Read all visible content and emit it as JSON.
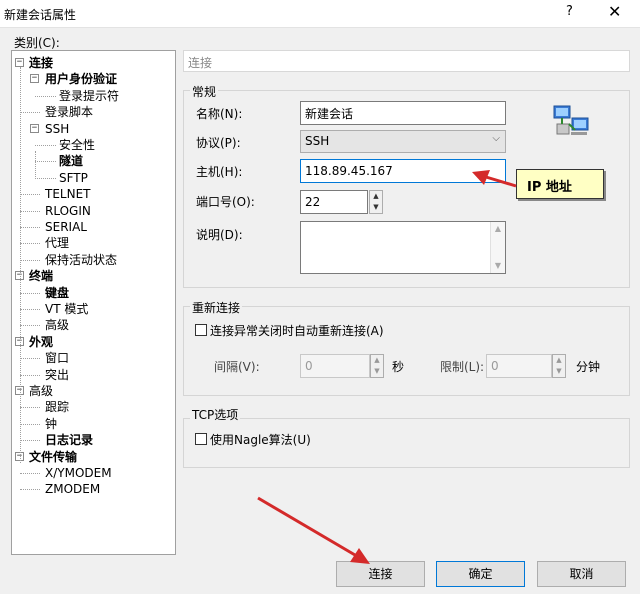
{
  "window": {
    "title": "新建会话属性",
    "help_label": "?",
    "close_label": "✕"
  },
  "category_label": "类别(C):",
  "tree": [
    {
      "label": "连接",
      "bold": true,
      "level": 0,
      "expander": "−"
    },
    {
      "label": "用户身份验证",
      "bold": true,
      "level": 1,
      "expander": "−"
    },
    {
      "label": "登录提示符",
      "bold": false,
      "level": 2
    },
    {
      "label": "登录脚本",
      "bold": false,
      "level": 1
    },
    {
      "label": "SSH",
      "bold": false,
      "level": 1,
      "expander": "−"
    },
    {
      "label": "安全性",
      "bold": false,
      "level": 2
    },
    {
      "label": "隧道",
      "bold": true,
      "level": 2
    },
    {
      "label": "SFTP",
      "bold": false,
      "level": 2
    },
    {
      "label": "TELNET",
      "bold": false,
      "level": 1
    },
    {
      "label": "RLOGIN",
      "bold": false,
      "level": 1
    },
    {
      "label": "SERIAL",
      "bold": false,
      "level": 1
    },
    {
      "label": "代理",
      "bold": false,
      "level": 1
    },
    {
      "label": "保持活动状态",
      "bold": false,
      "level": 1
    },
    {
      "label": "终端",
      "bold": true,
      "level": 0,
      "expander": "−"
    },
    {
      "label": "键盘",
      "bold": true,
      "level": 1
    },
    {
      "label": "VT 模式",
      "bold": false,
      "level": 1
    },
    {
      "label": "高级",
      "bold": false,
      "level": 1
    },
    {
      "label": "外观",
      "bold": true,
      "level": 0,
      "expander": "−"
    },
    {
      "label": "窗口",
      "bold": false,
      "level": 1
    },
    {
      "label": "突出",
      "bold": false,
      "level": 1
    },
    {
      "label": "高级",
      "bold": false,
      "level": 0,
      "expander": "−"
    },
    {
      "label": "跟踪",
      "bold": false,
      "level": 1
    },
    {
      "label": "钟",
      "bold": false,
      "level": 1
    },
    {
      "label": "日志记录",
      "bold": true,
      "level": 1
    },
    {
      "label": "文件传输",
      "bold": true,
      "level": 0,
      "expander": "−"
    },
    {
      "label": "X/YMODEM",
      "bold": false,
      "level": 1
    },
    {
      "label": "ZMODEM",
      "bold": false,
      "level": 1
    }
  ],
  "panel_header": "连接",
  "general": {
    "title": "常规",
    "name_label": "名称(N):",
    "name_value": "新建会话",
    "protocol_label": "协议(P):",
    "protocol_value": "SSH",
    "host_label": "主机(H):",
    "host_value": "118.89.45.167",
    "port_label": "端口号(O):",
    "port_value": "22",
    "desc_label": "说明(D):",
    "desc_value": "",
    "icon": "network-computers-icon"
  },
  "reconnect": {
    "title": "重新连接",
    "checkbox_label": "连接异常关闭时自动重新连接(A)",
    "checked": false,
    "interval_label": "间隔(V):",
    "interval_value": "0",
    "interval_unit": "秒",
    "limit_label": "限制(L):",
    "limit_value": "0",
    "limit_unit": "分钟"
  },
  "tcp": {
    "title": "TCP选项",
    "nagle_label": "使用Nagle算法(U)",
    "checked": false
  },
  "callout": {
    "text": "IP 地址"
  },
  "buttons": {
    "connect": "连接",
    "ok": "确定",
    "cancel": "取消"
  },
  "colors": {
    "annotation_arrow": "#d42a2a",
    "callout_bg": "#ffffc4",
    "focus_border": "#0078d7"
  }
}
